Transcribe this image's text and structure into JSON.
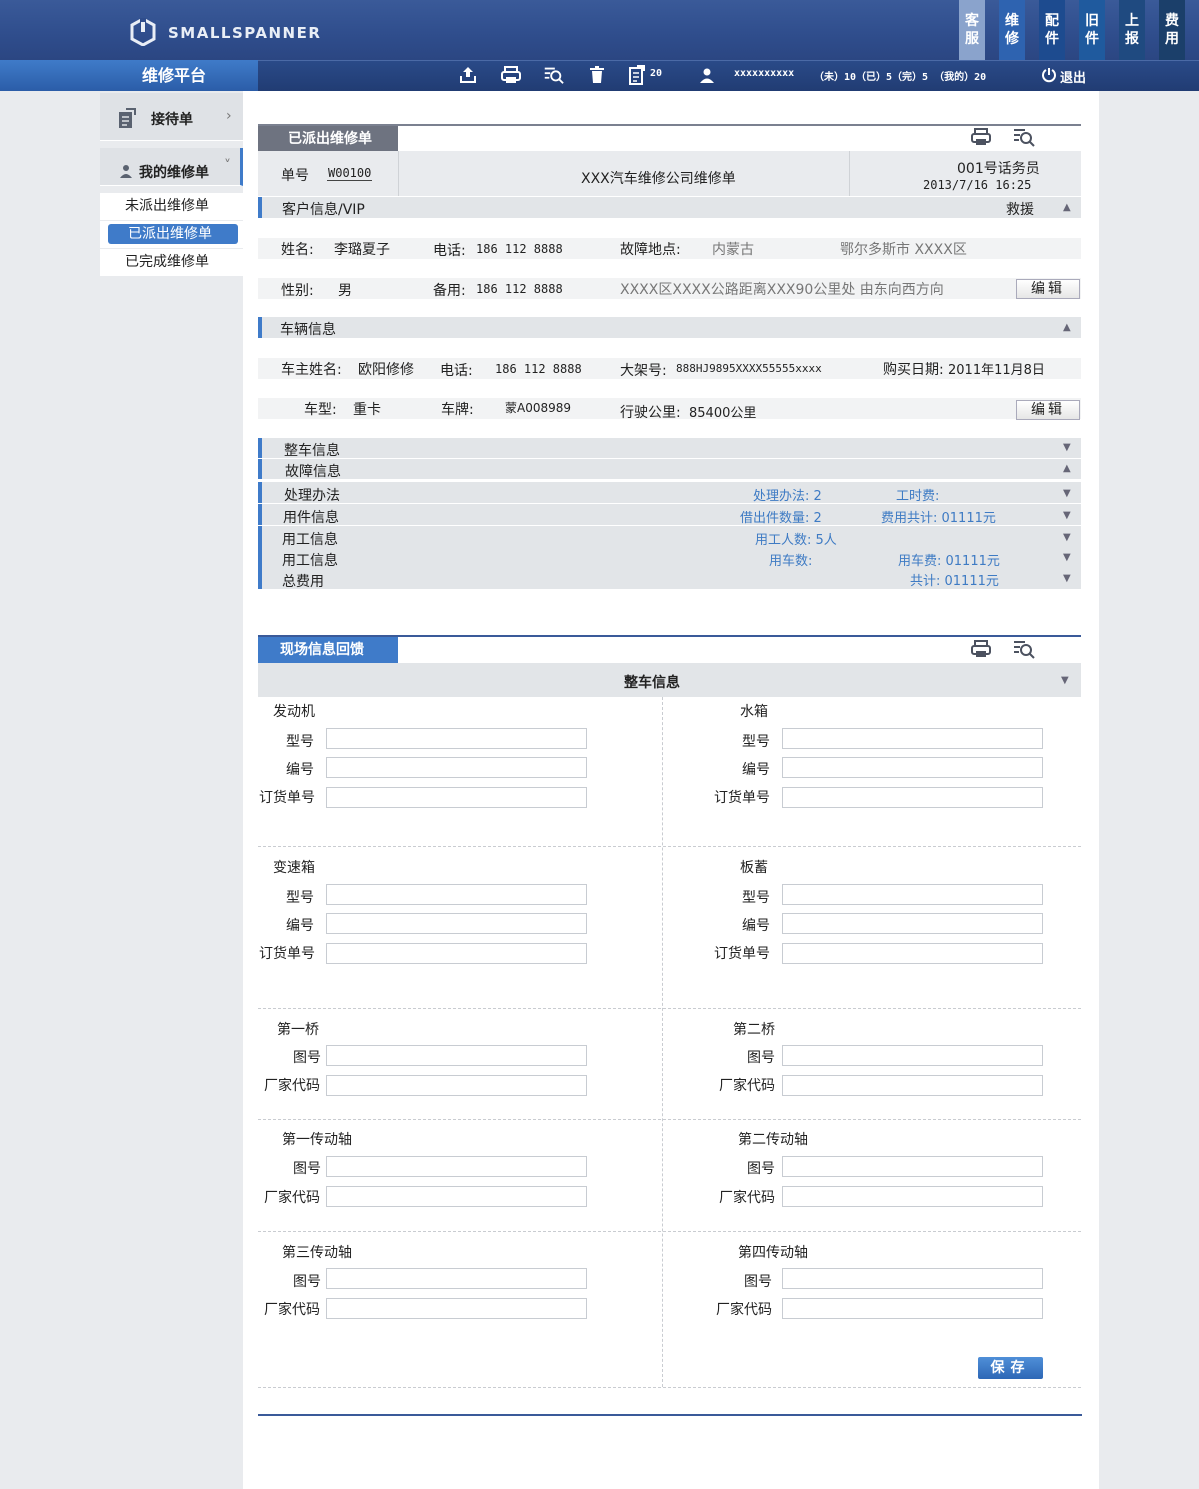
{
  "brand": "SMALLSPANNER",
  "platform_title": "维修平台",
  "quick_tabs": [
    {
      "c1": "客",
      "c2": "服"
    },
    {
      "c1": "维",
      "c2": "修"
    },
    {
      "c1": "配",
      "c2": "件"
    },
    {
      "c1": "旧",
      "c2": "件"
    },
    {
      "c1": "上",
      "c2": "报"
    },
    {
      "c1": "费",
      "c2": "用"
    }
  ],
  "toolbar": {
    "doc_count": "20",
    "user": "xxxxxxxxxx",
    "stats": "（未）10（已）5（完）5 （我的）20",
    "logout": "退出"
  },
  "sidebar": {
    "reception": "接待单",
    "my_orders": "我的维修单",
    "sub": [
      "未派出维修单",
      "已派出维修单",
      "已完成维修单"
    ]
  },
  "dispatched": {
    "title": "已派出维修单",
    "order_no_label": "单号",
    "order_no": "W00100",
    "company_title": "XXX汽车维修公司维修单",
    "operator": "001号话务员",
    "datetime": "2013/7/16  16:25",
    "customer_bar": "客户信息/VIP",
    "rescue": "救援",
    "name_label": "姓名:",
    "name": "李璐夏子",
    "phone_label": "电话:",
    "phone": "186 112 8888",
    "fault_loc_label": "故障地点:",
    "province": "内蒙古",
    "city": "鄂尔多斯市 XXXX区",
    "gender_label": "性别:",
    "gender": "男",
    "backup_label": "备用:",
    "backup": "186 112 8888",
    "address": "XXXX区XXXX公路距离XXX90公里处 由东向西方向",
    "edit": "编辑",
    "vehicle_bar": "车辆信息",
    "owner_label": "车主姓名:",
    "owner": "欧阳修修",
    "owner_phone_label": "电话:",
    "owner_phone": "186 112 8888",
    "frame_label": "大架号:",
    "frame": "888HJ9895XXXX55555xxxx",
    "buy_date_label": "购买日期:",
    "buy_date": "2011年11月8日",
    "model_label": "车型:",
    "model": "重卡",
    "plate_label": "车牌:",
    "plate": "蒙A008989",
    "mileage_label": "行驶公里:",
    "mileage": "85400公里",
    "bars": [
      {
        "label": "整车信息",
        "a": "",
        "b": "",
        "arrow": "▼"
      },
      {
        "label": "故障信息",
        "a": "",
        "b": "",
        "arrow": "▲"
      },
      {
        "label": "处理办法",
        "a": "处理办法: 2",
        "b": "工时费:",
        "arrow": "▼"
      },
      {
        "label": "用件信息",
        "a": "借出件数量: 2",
        "b": "费用共计:  01111元",
        "arrow": "▼"
      },
      {
        "label": "用工信息",
        "a": "用工人数: 5人",
        "b": "",
        "arrow": "▼"
      },
      {
        "label": "用工信息",
        "a": "用车数:",
        "b": "用车费:  01111元",
        "arrow": "▼"
      },
      {
        "label": "总费用",
        "a": "",
        "b": "共计:  01111元",
        "arrow": "▼"
      }
    ]
  },
  "feedback": {
    "title": "现场信息回馈",
    "whole_vehicle": "整车信息",
    "save": "保存",
    "groups": [
      {
        "left": {
          "name": "发动机",
          "fields": [
            "型号",
            "编号",
            "订货单号"
          ]
        },
        "right": {
          "name": "水箱",
          "fields": [
            "型号",
            "编号",
            "订货单号"
          ]
        }
      },
      {
        "left": {
          "name": "变速箱",
          "fields": [
            "型号",
            "编号",
            "订货单号"
          ]
        },
        "right": {
          "name": "板蓄",
          "fields": [
            "型号",
            "编号",
            "订货单号"
          ]
        }
      },
      {
        "left": {
          "name": "第一桥",
          "fields": [
            "图号",
            "厂家代码"
          ]
        },
        "right": {
          "name": "第二桥",
          "fields": [
            "图号",
            "厂家代码"
          ]
        }
      },
      {
        "left": {
          "name": "第一传动轴",
          "fields": [
            "图号",
            "厂家代码"
          ]
        },
        "right": {
          "name": "第二传动轴",
          "fields": [
            "图号",
            "厂家代码"
          ]
        }
      },
      {
        "left": {
          "name": "第三传动轴",
          "fields": [
            "图号",
            "厂家代码"
          ]
        },
        "right": {
          "name": "第四传动轴",
          "fields": [
            "图号",
            "厂家代码"
          ]
        }
      }
    ]
  },
  "colors": {
    "accent": "#3f7bc9",
    "header": "#2f4d8c",
    "section_title": "#6e7380"
  }
}
